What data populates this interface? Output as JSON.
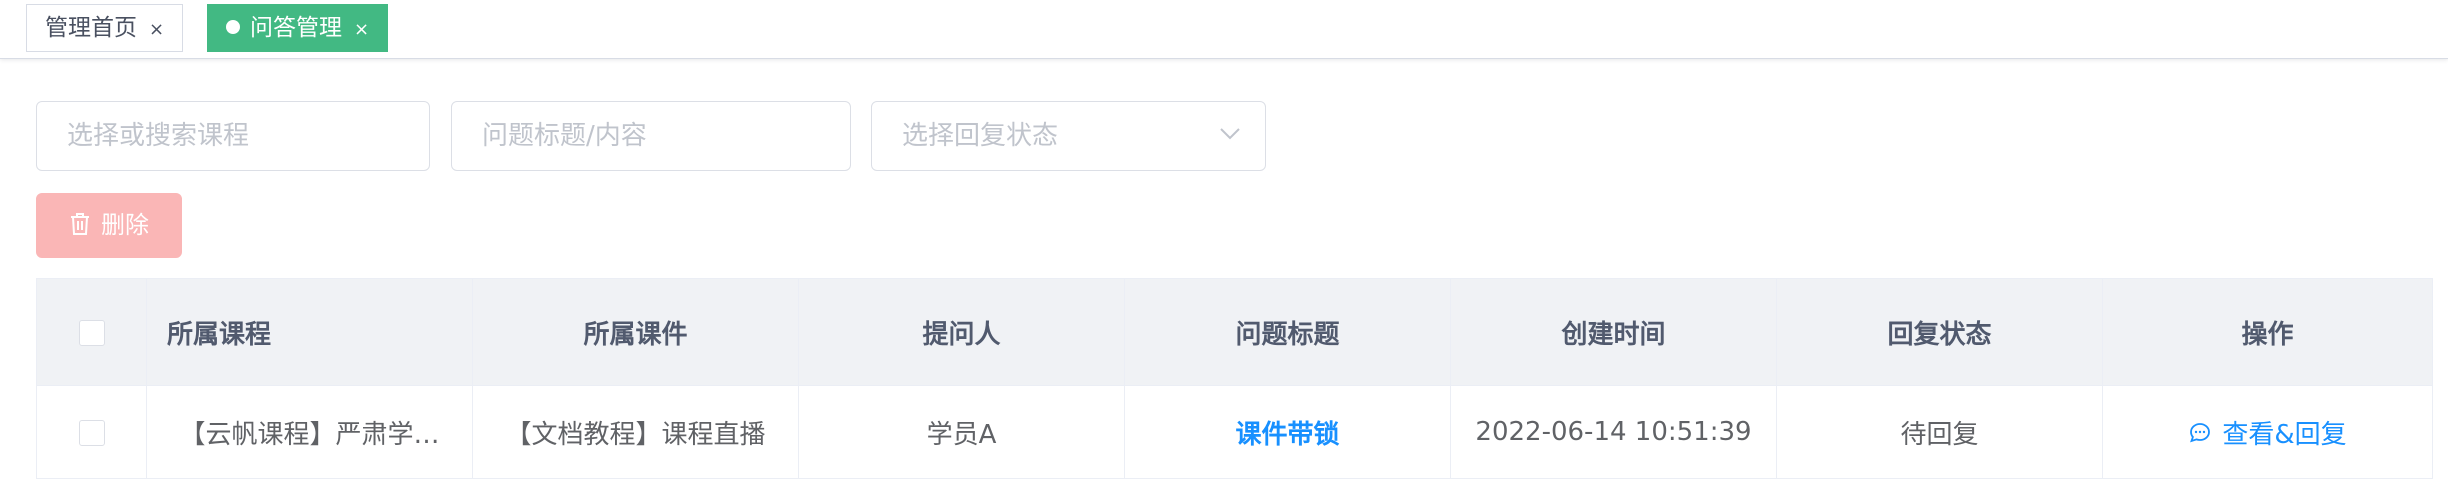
{
  "tabs": [
    {
      "label": "管理首页",
      "close": "×"
    },
    {
      "label": "问答管理",
      "close": "×"
    }
  ],
  "filters": {
    "course_placeholder": "选择或搜索课程",
    "title_placeholder": "问题标题/内容",
    "status_placeholder": "选择回复状态"
  },
  "toolbar": {
    "delete_label": "删除"
  },
  "table": {
    "headers": [
      "所属课程",
      "所属课件",
      "提问人",
      "问题标题",
      "创建时间",
      "回复状态",
      "操作"
    ],
    "rows": [
      {
        "course": "【云帆课程】严肃学…",
        "courseware": "【文档教程】课程直播",
        "asker": "学员A",
        "title": "课件带锁",
        "created": "2022-06-14 10:51:39",
        "status": "待回复",
        "action": "查看&回复"
      }
    ]
  },
  "colors": {
    "active_tab": "#42b983",
    "link": "#1890ff",
    "delete_disabled": "#fab6b6"
  }
}
